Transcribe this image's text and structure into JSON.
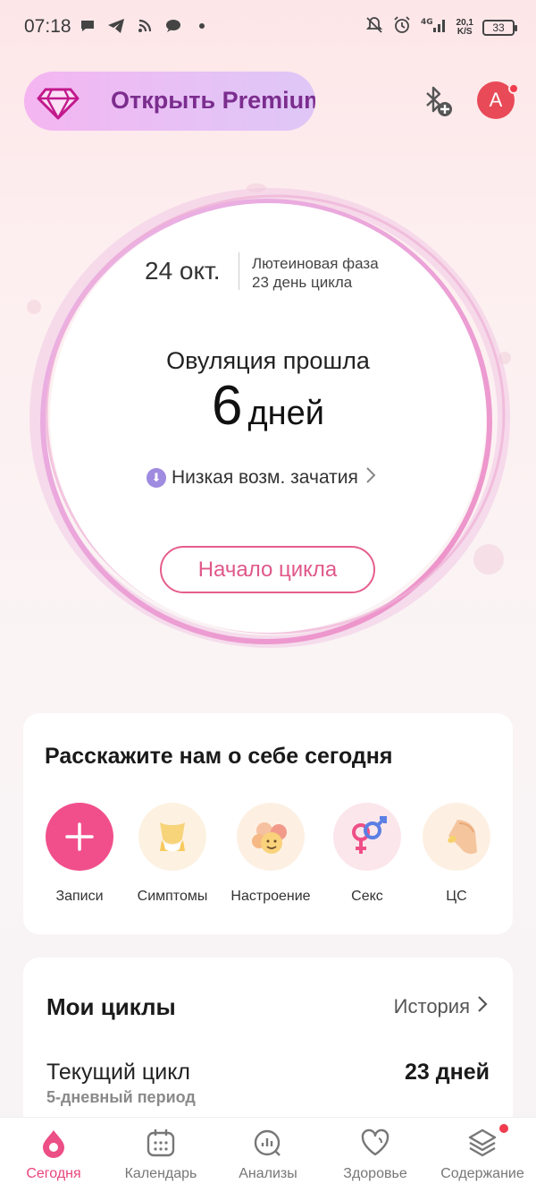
{
  "status_bar": {
    "time": "07:18",
    "net_speed_value": "20,1",
    "net_speed_unit": "K/S",
    "network": "4G",
    "battery": "33",
    "left_icons": [
      "chat-bubble-icon",
      "telegram-icon",
      "rss-icon",
      "message-icon",
      "dot-icon"
    ],
    "right_icons": [
      "notifications-off-icon",
      "alarm-icon",
      "signal-icon",
      "battery-icon"
    ]
  },
  "header": {
    "premium_label": "Открыть Premium",
    "avatar_letter": "A"
  },
  "cycle": {
    "date": "24 окт.",
    "phase": "Лютеиновая фаза",
    "cycle_day": "23 день цикла",
    "ovulation_label": "Овуляция прошла",
    "ovulation_days_number": "6",
    "ovulation_days_unit": "дней",
    "conception_chance": "Низкая возм. зачатия",
    "start_button": "Начало цикла"
  },
  "today_card": {
    "title": "Расскажите нам о себе сегодня",
    "items": [
      {
        "label": "Записи",
        "icon": "plus-icon"
      },
      {
        "label": "Симптомы",
        "icon": "body-icon"
      },
      {
        "label": "Настроение",
        "icon": "mood-faces-icon"
      },
      {
        "label": "Секс",
        "icon": "gender-symbols-icon"
      },
      {
        "label": "ЦС",
        "icon": "pill-hand-icon"
      }
    ]
  },
  "cycles_card": {
    "title": "Мои циклы",
    "history_label": "История",
    "current_cycle_label": "Текущий цикл",
    "current_period": "5-дневный период",
    "current_days": "23 дней"
  },
  "bottom_nav": {
    "items": [
      {
        "label": "Сегодня",
        "icon": "drop-icon",
        "active": true
      },
      {
        "label": "Календарь",
        "icon": "calendar-icon",
        "active": false
      },
      {
        "label": "Анализы",
        "icon": "analytics-icon",
        "active": false
      },
      {
        "label": "Здоровье",
        "icon": "heart-icon",
        "active": false
      },
      {
        "label": "Содержание",
        "icon": "layers-icon",
        "active": false
      }
    ]
  },
  "colors": {
    "accent": "#e8457e",
    "avatar": "#e94a58",
    "premium_text": "#7b2d8e"
  }
}
